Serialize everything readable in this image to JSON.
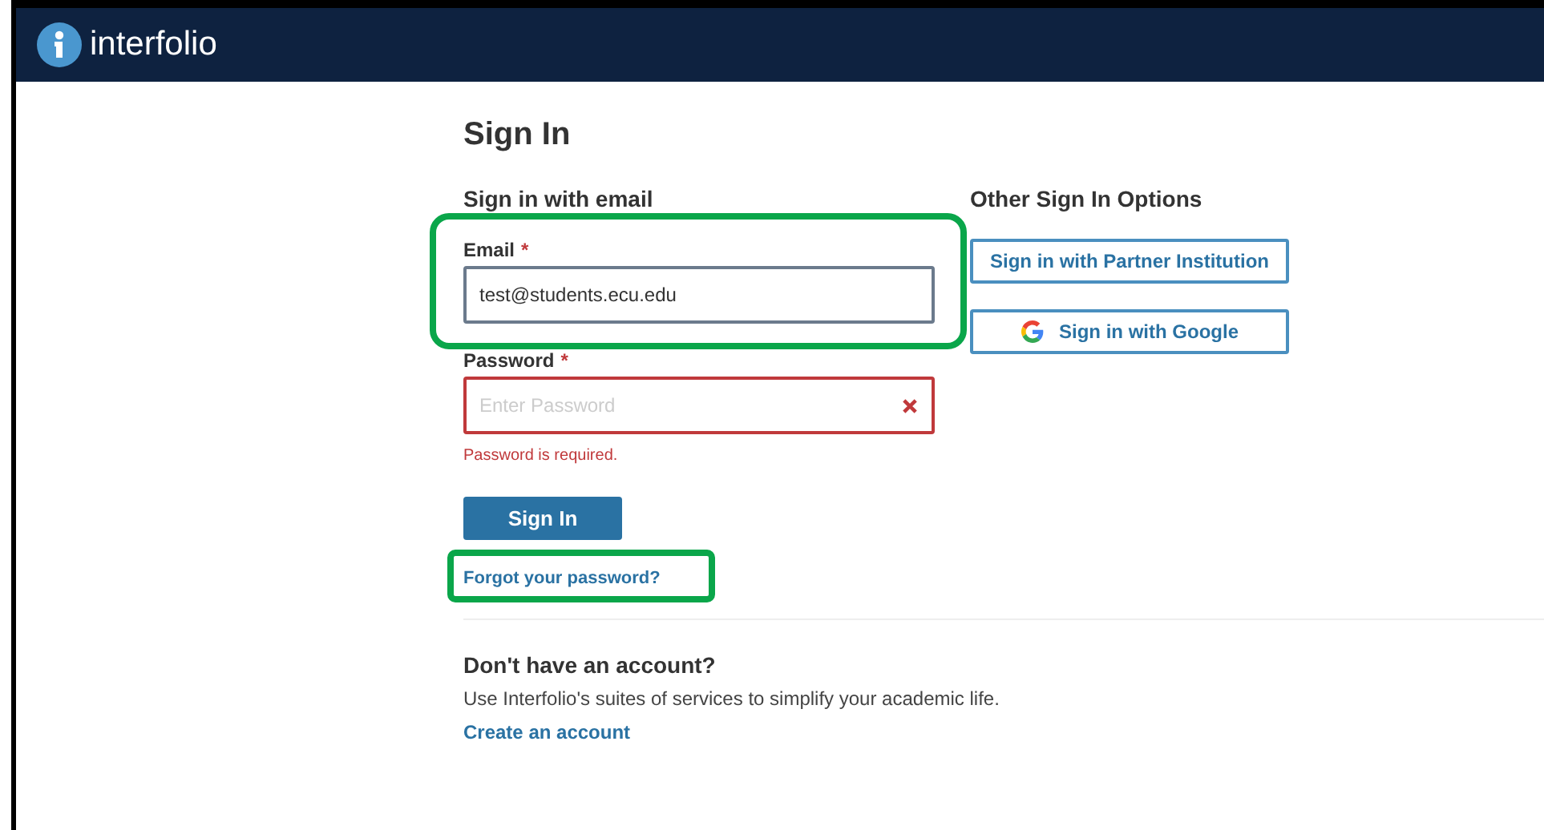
{
  "header": {
    "brand": "interfolio"
  },
  "title": "Sign In",
  "email_section": {
    "heading": "Sign in with email",
    "email": {
      "label": "Email",
      "required_mark": "*",
      "value": "test@students.ecu.edu",
      "invalid": false
    },
    "password": {
      "label": "Password",
      "required_mark": "*",
      "placeholder": "Enter Password",
      "invalid": true,
      "error": "Password is required."
    },
    "submit": "Sign In",
    "forgot_link": "Forgot your password?"
  },
  "other_options": {
    "heading": "Other Sign In Options",
    "buttons": [
      {
        "kind": "plain",
        "label": "Sign in with Partner Institution"
      },
      {
        "kind": "google",
        "label": "Sign in with Google"
      }
    ]
  },
  "signup": {
    "heading": "Don't have an account?",
    "text": "Use Interfolio's suites of services to simplify your academic life.",
    "link": "Create an account"
  }
}
